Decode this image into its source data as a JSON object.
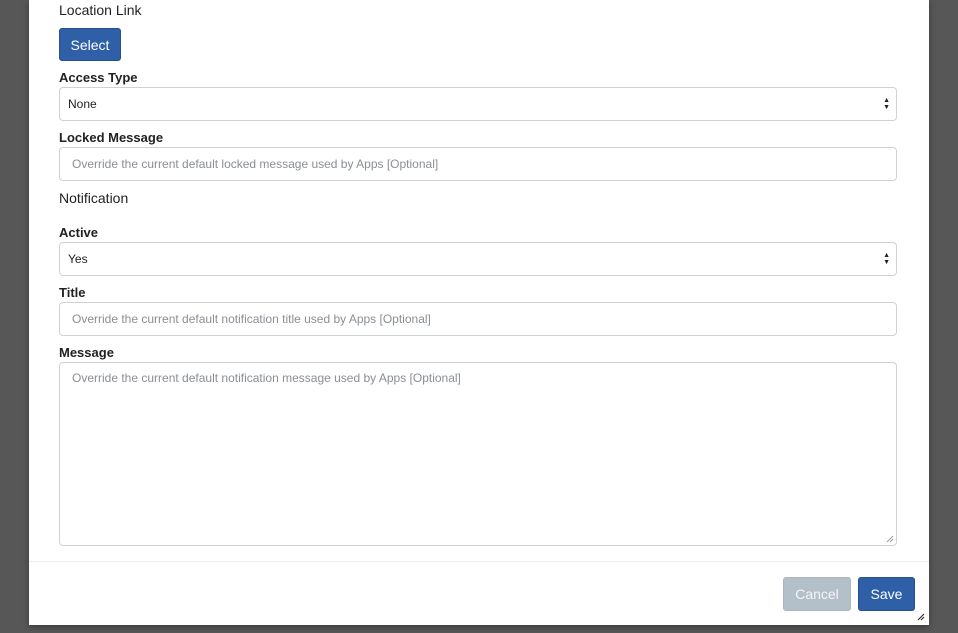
{
  "location": {
    "title": "Location Link",
    "select_label": "Select"
  },
  "access": {
    "label": "Access Type",
    "value": "None"
  },
  "locked": {
    "label": "Locked Message",
    "placeholder": "Override the current default locked message used by Apps [Optional]"
  },
  "notification": {
    "title": "Notification",
    "active_label": "Active",
    "active_value": "Yes",
    "title_label": "Title",
    "title_placeholder": "Override the current default notification title used by Apps [Optional]",
    "message_label": "Message",
    "message_placeholder": "Override the current default notification message used by Apps [Optional]"
  },
  "footer": {
    "cancel_label": "Cancel",
    "save_label": "Save"
  },
  "colors": {
    "primary": "#2e5fa7",
    "cancel": "#b3bfc9",
    "backdrop": "#575757"
  }
}
